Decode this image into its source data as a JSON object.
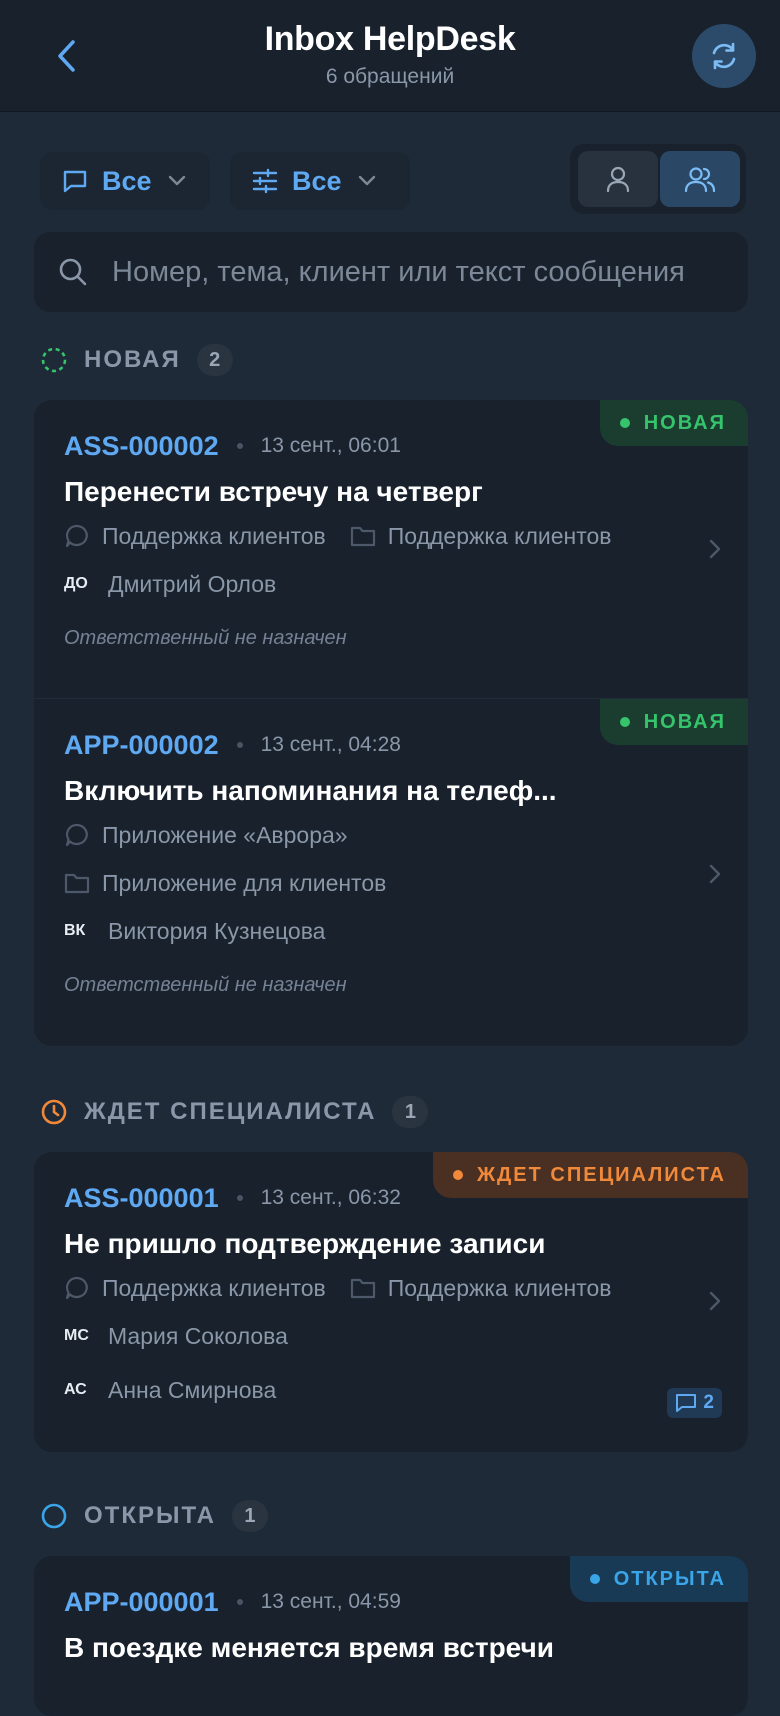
{
  "header": {
    "title": "Inbox HelpDesk",
    "subtitle": "6 обращений"
  },
  "filters": {
    "channel_label": "Все",
    "params_label": "Все"
  },
  "search": {
    "placeholder": "Номер, тема, клиент или текст сообщения"
  },
  "sections": [
    {
      "title": "НОВАЯ",
      "count": "2",
      "icon": "dashed-circle-icon",
      "color": "#35c46c",
      "tickets": [
        {
          "id": "ASS-000002",
          "time": "13 сент., 06:01",
          "subject": "Перенести встречу на четверг",
          "status": "НОВАЯ",
          "channel": "Поддержка клиентов",
          "queue": "Поддержка клиентов",
          "client_initials": "ДО",
          "client_name": "Дмитрий Орлов",
          "assignee": "Ответственный не назначен"
        },
        {
          "id": "APP-000002",
          "time": "13 сент., 04:28",
          "subject": "Включить напоминания на телеф...",
          "status": "НОВАЯ",
          "channel": "Приложение «Аврора»",
          "queue": "Приложение для клиентов",
          "client_initials": "ВК",
          "client_name": "Виктория Кузнецова",
          "assignee": "Ответственный не назначен"
        }
      ]
    },
    {
      "title": "ЖДЕТ СПЕЦИАЛИСТА",
      "count": "1",
      "icon": "clock-icon",
      "color": "#f08a3a",
      "tickets": [
        {
          "id": "ASS-000001",
          "time": "13 сент., 06:32",
          "subject": "Не пришло подтверждение записи",
          "status": "ЖДЕТ СПЕЦИАЛИСТА",
          "channel": "Поддержка клиентов",
          "queue": "Поддержка клиентов",
          "client_initials": "МС",
          "client_name": "Мария Соколова",
          "assignee_initials": "АС",
          "assignee_name": "Анна Смирнова",
          "comments": "2"
        }
      ]
    },
    {
      "title": "ОТКРЫТА",
      "count": "1",
      "icon": "circle-icon",
      "color": "#3aa6e8",
      "tickets": [
        {
          "id": "APP-000001",
          "time": "13 сент., 04:59",
          "subject": "В поездке меняется время встречи",
          "status": "ОТКРЫТА"
        }
      ]
    }
  ]
}
